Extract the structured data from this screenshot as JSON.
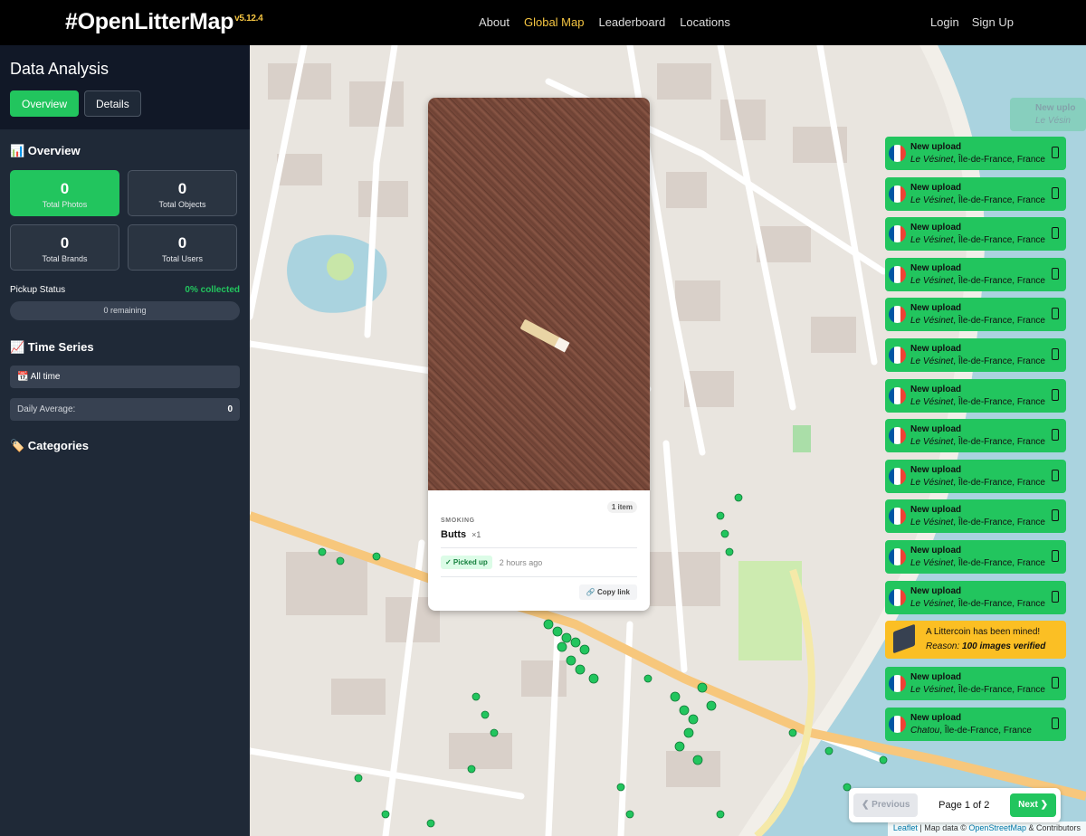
{
  "header": {
    "brand": "#OpenLitterMap",
    "version": "v5.12.4",
    "nav": [
      "About",
      "Global Map",
      "Leaderboard",
      "Locations"
    ],
    "login": "Login",
    "signup": "Sign Up"
  },
  "sidebar": {
    "title": "Data Analysis",
    "tab_overview": "Overview",
    "tab_details": "Details",
    "overview_heading": "📊 Overview",
    "stats": [
      {
        "value": "0",
        "label": "Total Photos"
      },
      {
        "value": "0",
        "label": "Total Objects"
      },
      {
        "value": "0",
        "label": "Total Brands"
      },
      {
        "value": "0",
        "label": "Total Users"
      }
    ],
    "pickup_label": "Pickup Status",
    "pickup_value": "0% collected",
    "pickup_remaining": "0 remaining",
    "timeseries_heading": "📈 Time Series",
    "timeframe": "📆 All time",
    "daily_avg_label": "Daily Average:",
    "daily_avg_value": "0",
    "categories_heading": "🏷️ Categories"
  },
  "popup": {
    "items_badge": "1 item",
    "category": "SMOKING",
    "object": "Butts",
    "quantity": "×1",
    "status": "✓ Picked up",
    "time": "2 hours ago",
    "copy": "Copy link"
  },
  "notifications": [
    {
      "title": "New upload",
      "place": "Le Vésinet",
      "region": ", Île-de-France, ",
      "country": "France"
    },
    {
      "title": "New upload",
      "place": "Le Vésinet",
      "region": ", Île-de-France, ",
      "country": "France"
    },
    {
      "title": "New upload",
      "place": "Le Vésinet",
      "region": ", Île-de-France, ",
      "country": "France"
    },
    {
      "title": "New upload",
      "place": "Le Vésinet",
      "region": ", Île-de-France, ",
      "country": "France"
    },
    {
      "title": "New upload",
      "place": "Le Vésinet",
      "region": ", Île-de-France, ",
      "country": "France"
    },
    {
      "title": "New upload",
      "place": "Le Vésinet",
      "region": ", Île-de-France, ",
      "country": "France"
    },
    {
      "title": "New upload",
      "place": "Le Vésinet",
      "region": ", Île-de-France, ",
      "country": "France"
    },
    {
      "title": "New upload",
      "place": "Le Vésinet",
      "region": ", Île-de-France, ",
      "country": "France"
    },
    {
      "title": "New upload",
      "place": "Le Vésinet",
      "region": ", Île-de-France, ",
      "country": "France"
    },
    {
      "title": "New upload",
      "place": "Le Vésinet",
      "region": ", Île-de-France, ",
      "country": "France"
    },
    {
      "title": "New upload",
      "place": "Le Vésinet",
      "region": ", Île-de-France, ",
      "country": "France"
    },
    {
      "title": "New upload",
      "place": "Le Vésinet",
      "region": ", Île-de-France, ",
      "country": "France"
    }
  ],
  "littercoin": {
    "title": "A Littercoin has been mined!",
    "reason_label": "Reason:",
    "reason": "100 images verified"
  },
  "notifications_after": [
    {
      "title": "New upload",
      "place": "Le Vésinet",
      "region": ", Île-de-France, ",
      "country": "France"
    },
    {
      "title": "New upload",
      "place": "Chatou",
      "region": ", Île-de-France, ",
      "country": "France"
    }
  ],
  "ghost_note": {
    "title": "New uplo",
    "place": "Le Vésin"
  },
  "pager": {
    "prev": "Previous",
    "info": "Page 1 of 2",
    "next": "Next"
  },
  "attribution": {
    "leaflet": "Leaflet",
    "mid": " | Map data © ",
    "osm": "OpenStreetMap",
    "end": " & Contributors"
  },
  "colors": {
    "accent": "#22c55e",
    "gold": "#f5c542",
    "sidebar": "#1f2937"
  }
}
